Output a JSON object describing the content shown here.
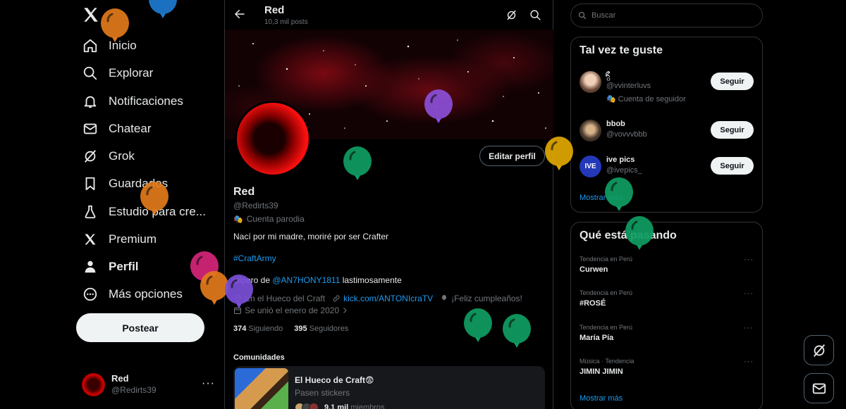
{
  "nav": {
    "items": [
      {
        "label": "Inicio",
        "icon": "home-icon"
      },
      {
        "label": "Explorar",
        "icon": "search-icon"
      },
      {
        "label": "Notificaciones",
        "icon": "bell-icon"
      },
      {
        "label": "Chatear",
        "icon": "mail-icon"
      },
      {
        "label": "Grok",
        "icon": "grok-icon"
      },
      {
        "label": "Guardados",
        "icon": "bookmark-icon"
      },
      {
        "label": "Estudio para cre...",
        "icon": "flask-icon"
      },
      {
        "label": "Premium",
        "icon": "x-logo-icon"
      },
      {
        "label": "Perfil",
        "icon": "person-icon"
      },
      {
        "label": "Más opciones",
        "icon": "more-circle-icon"
      }
    ],
    "post_label": "Postear",
    "account": {
      "name": "Red",
      "handle": "@Redirts39",
      "more": "···"
    }
  },
  "header": {
    "name": "Red",
    "posts": "10,3 mil posts"
  },
  "profile": {
    "edit_label": "Editar perfil",
    "name": "Red",
    "handle": "@Redirts39",
    "parody_mask": "🎭",
    "parody": "Cuenta parodia",
    "bio_line1": "Nací por mi madre, moriré por ser Crafter",
    "hashtag": "#CraftArmy",
    "bio_line2_pre": "clipero de ",
    "bio_line2_link": "@AN7HONY1811",
    "bio_line2_post": " lastimosamente",
    "location": "En el Hueco del Craft",
    "website": "kick.com/ANTONIcraTV",
    "birthday": "¡Feliz cumpleaños!",
    "joined": "Se unió el enero de 2020",
    "following_count": "374",
    "following_label": "Siguiendo",
    "followers_count": "395",
    "followers_label": "Seguidores"
  },
  "communities": {
    "title": "Comunidades",
    "card": {
      "name": "El Hueco de Craft😨",
      "sub": "Pasen stickers",
      "members_count": "9,1 mil",
      "members_label": "miembros"
    }
  },
  "search": {
    "placeholder": "Buscar"
  },
  "suggestions": {
    "title": "Tal vez te guste",
    "items": [
      {
        "name": "ིྀ",
        "handle": "@vvinterluvs",
        "extra": "🎭 Cuenta de seguidor",
        "button": "Seguir"
      },
      {
        "name": "bbob",
        "handle": "@vovvvbbb",
        "button": "Seguir"
      },
      {
        "name": "ive pics",
        "handle": "@ivepics_",
        "button": "Seguir",
        "avatar_text": "IVE"
      }
    ],
    "show_more": "Mostrar más"
  },
  "trends": {
    "title": "Qué está pasando",
    "items": [
      {
        "context": "Tendencia en Perú",
        "topic": "Curwen"
      },
      {
        "context": "Tendencia en Perú",
        "topic": "#ROSÉ"
      },
      {
        "context": "Tendencia en Perú",
        "topic": "María Pía"
      },
      {
        "context": "Música · Tendencia",
        "topic": "JIMIN JIMIN"
      }
    ],
    "more": "···",
    "show_more": "Mostrar más"
  },
  "colors": {
    "accent": "#1d9bf0",
    "background": "#000000",
    "border": "#2f3336",
    "muted": "#71767b"
  },
  "balloons": [
    {
      "color": "#e2791a"
    },
    {
      "color": "#1d7bcf"
    },
    {
      "color": "#8b4fd8"
    },
    {
      "color": "#0f9d63"
    },
    {
      "color": "#e2791a"
    },
    {
      "color": "#e1a800"
    },
    {
      "color": "#0f9d63"
    },
    {
      "color": "#0f9d63"
    },
    {
      "color": "#d6257a"
    },
    {
      "color": "#e2791a"
    },
    {
      "color": "#7b4fd8"
    },
    {
      "color": "#0f9d63"
    },
    {
      "color": "#0f9d63"
    }
  ]
}
